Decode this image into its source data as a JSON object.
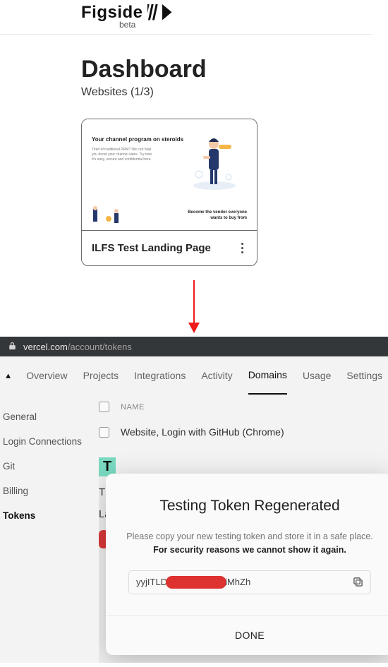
{
  "figside": {
    "brand": "Figside",
    "beta": "beta",
    "dashboard_title": "Dashboard",
    "websites_count": "Websites (1/3)",
    "card": {
      "thumb_heading": "Your channel program on steroids",
      "thumb_sub": "Tired of traditional PRM? We can help you boost your channel sales. Try now. It's easy, secure and confidential here.",
      "thumb_tagline": "Become the vendor everyone wants to buy from",
      "title": "ILFS Test Landing Page"
    }
  },
  "vercel": {
    "url_host": "vercel.com",
    "url_path": "/account/tokens",
    "tabs": {
      "overview": "Overview",
      "projects": "Projects",
      "integrations": "Integrations",
      "activity": "Activity",
      "domains": "Domains",
      "usage": "Usage",
      "settings": "Settings"
    },
    "sidebar": {
      "general": "General",
      "login_connections": "Login Connections",
      "git": "Git",
      "billing": "Billing",
      "tokens": "Tokens"
    },
    "table": {
      "name_header": "NAME",
      "row0_desc": "Website, Login with GitHub (Chrome)"
    },
    "peek": {
      "badge": "T",
      "line1": "Th",
      "line2": "La"
    },
    "modal": {
      "title": "Testing Token Regenerated",
      "subtitle": "Please copy your new testing token and store it in a safe place.",
      "warning": "For security reasons we cannot show it again.",
      "token_prefix": "yyjITLD",
      "token_suffix": "iMhZh",
      "done": "DONE"
    }
  }
}
